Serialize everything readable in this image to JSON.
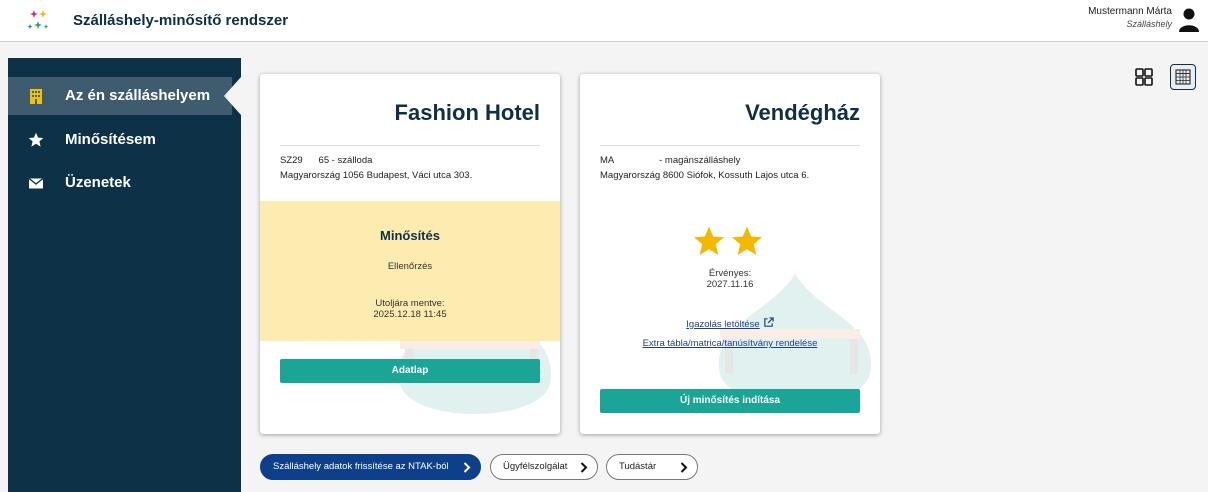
{
  "header": {
    "app_title": "Szálláshely-minősítő rendszer",
    "user_name": "Mustermann Márta",
    "user_role": "Szálláshely",
    "logo_icon": "sparkles-logo",
    "user_icon": "user-icon"
  },
  "sidebar": {
    "items": [
      {
        "label": "Az én szálláshelyem",
        "icon": "building-icon",
        "active": true
      },
      {
        "label": "Minősítésem",
        "icon": "star-icon",
        "active": false
      },
      {
        "label": "Üzenetek",
        "icon": "envelope-icon",
        "active": false
      }
    ]
  },
  "view_toggle": {
    "grid_icon": "grid-view-icon",
    "table_icon": "table-view-icon",
    "selected": "table"
  },
  "cards": [
    {
      "title": "Fashion Hotel",
      "id_line": "SZ29      65 - szálloda",
      "address": "Magyarország 1056 Budapest, Váci utca 303.",
      "rating_title": "Minősítés",
      "rating_status": "Ellenőrzés",
      "saved_label": "Utoljára mentve:",
      "saved_date": "2025.12.18 11:45",
      "button_label": "Adatlap"
    },
    {
      "title": "Vendégház",
      "id_line": "MA                 - magánszálláshely",
      "address": "Magyarország 8600 Siófok, Kossuth Lajos utca 6.",
      "stars": 2,
      "valid_label": "Érvényes:",
      "valid_date": "2027.11.16",
      "link_certificate": "Igazolás letöltése",
      "link_order": "Extra tábla/matrica/tanúsítvány rendelése",
      "button_label": "Új minősítés indítása"
    }
  ],
  "bottom_buttons": {
    "refresh": "Szálláshely adatok frissítése az NTAK-ból",
    "support": "Ügyfélszolgálat",
    "knowledge": "Tudástár"
  },
  "colors": {
    "sidebar_bg": "#0d3247",
    "accent_teal": "#1aa596",
    "primary_blue": "#0e3f8a",
    "rating_bg": "#fdecb0",
    "star": "#f5b800"
  }
}
